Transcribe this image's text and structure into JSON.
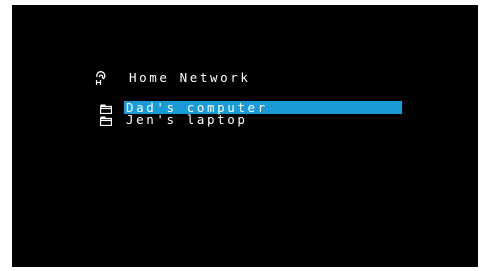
{
  "header": {
    "icon": "network-icon",
    "title": "Home Network"
  },
  "items": [
    {
      "icon": "folder-icon",
      "label": "Dad's computer",
      "selected": true
    },
    {
      "icon": "folder-icon",
      "label": "Jen's laptop",
      "selected": false
    }
  ],
  "colors": {
    "background": "#000000",
    "text": "#ffffff",
    "highlight": "#1a9bd6"
  }
}
